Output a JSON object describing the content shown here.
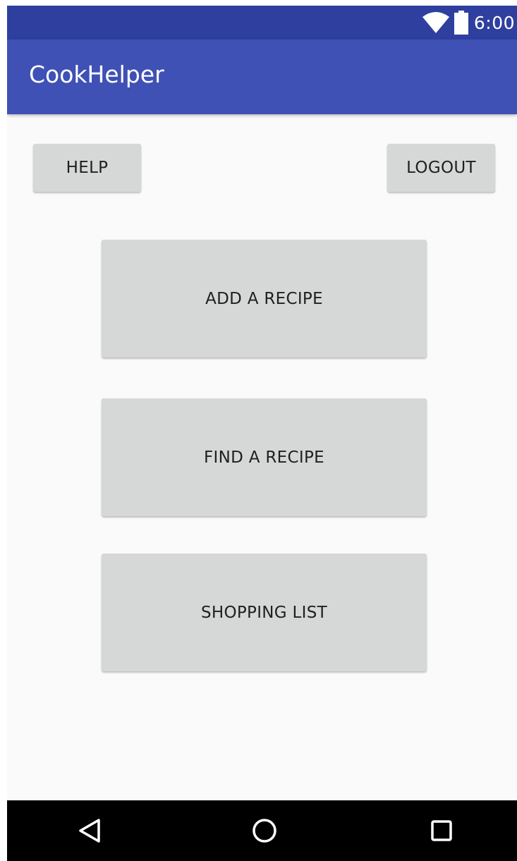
{
  "status_bar": {
    "time": "6:00",
    "icons": [
      "wifi-icon",
      "battery-icon"
    ],
    "color": "#2f3f9f"
  },
  "app_bar": {
    "title": "CookHelper",
    "color": "#3f51b5"
  },
  "top_buttons": {
    "help_label": "HELP",
    "logout_label": "LOGOUT"
  },
  "main_buttons": {
    "add_recipe_label": "ADD A RECIPE",
    "find_recipe_label": "FIND A RECIPE",
    "shopping_list_label": "SHOPPING LIST"
  },
  "nav_bar": {
    "icons": [
      "back-icon",
      "home-icon",
      "recents-icon"
    ],
    "color": "#000000"
  },
  "colors": {
    "button": "#d6d7d7",
    "background": "#fafafa",
    "button_text": "#1f1f1f"
  }
}
